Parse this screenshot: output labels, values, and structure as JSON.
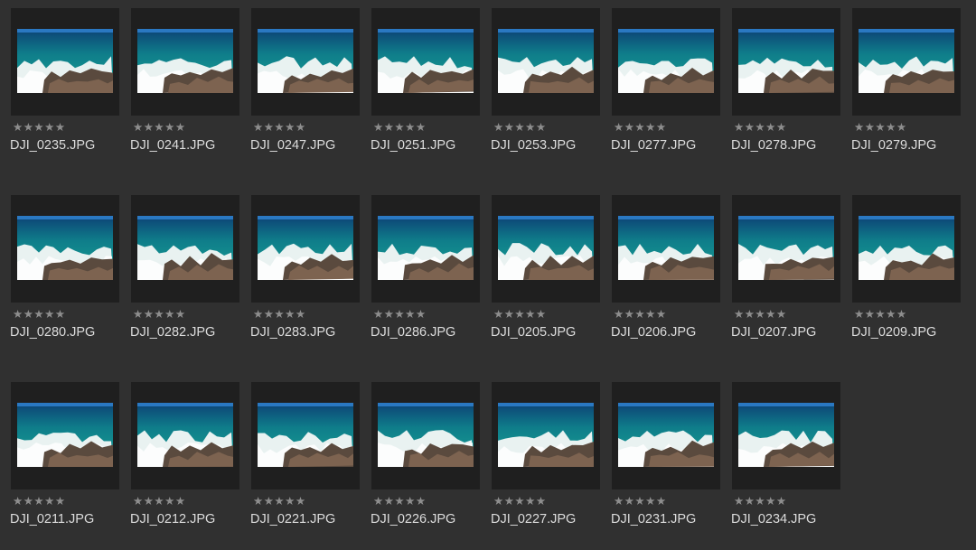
{
  "rating_glyph": "★",
  "colors": {
    "background": "#303030",
    "frame": "#1f1f1f",
    "star": "#8e8e8e",
    "filename": "#dcdcdc"
  },
  "photos": [
    {
      "filename": "DJI_0235.JPG",
      "rating": 5
    },
    {
      "filename": "DJI_0241.JPG",
      "rating": 5
    },
    {
      "filename": "DJI_0247.JPG",
      "rating": 5
    },
    {
      "filename": "DJI_0251.JPG",
      "rating": 5
    },
    {
      "filename": "DJI_0253.JPG",
      "rating": 5
    },
    {
      "filename": "DJI_0277.JPG",
      "rating": 5
    },
    {
      "filename": "DJI_0278.JPG",
      "rating": 5
    },
    {
      "filename": "DJI_0279.JPG",
      "rating": 5
    },
    {
      "filename": "DJI_0280.JPG",
      "rating": 5
    },
    {
      "filename": "DJI_0282.JPG",
      "rating": 5
    },
    {
      "filename": "DJI_0283.JPG",
      "rating": 5
    },
    {
      "filename": "DJI_0286.JPG",
      "rating": 5
    },
    {
      "filename": "DJI_0205.JPG",
      "rating": 5
    },
    {
      "filename": "DJI_0206.JPG",
      "rating": 5
    },
    {
      "filename": "DJI_0207.JPG",
      "rating": 5
    },
    {
      "filename": "DJI_0209.JPG",
      "rating": 5
    },
    {
      "filename": "DJI_0211.JPG",
      "rating": 5
    },
    {
      "filename": "DJI_0212.JPG",
      "rating": 5
    },
    {
      "filename": "DJI_0221.JPG",
      "rating": 5
    },
    {
      "filename": "DJI_0226.JPG",
      "rating": 5
    },
    {
      "filename": "DJI_0227.JPG",
      "rating": 5
    },
    {
      "filename": "DJI_0231.JPG",
      "rating": 5
    },
    {
      "filename": "DJI_0234.JPG",
      "rating": 5
    }
  ]
}
